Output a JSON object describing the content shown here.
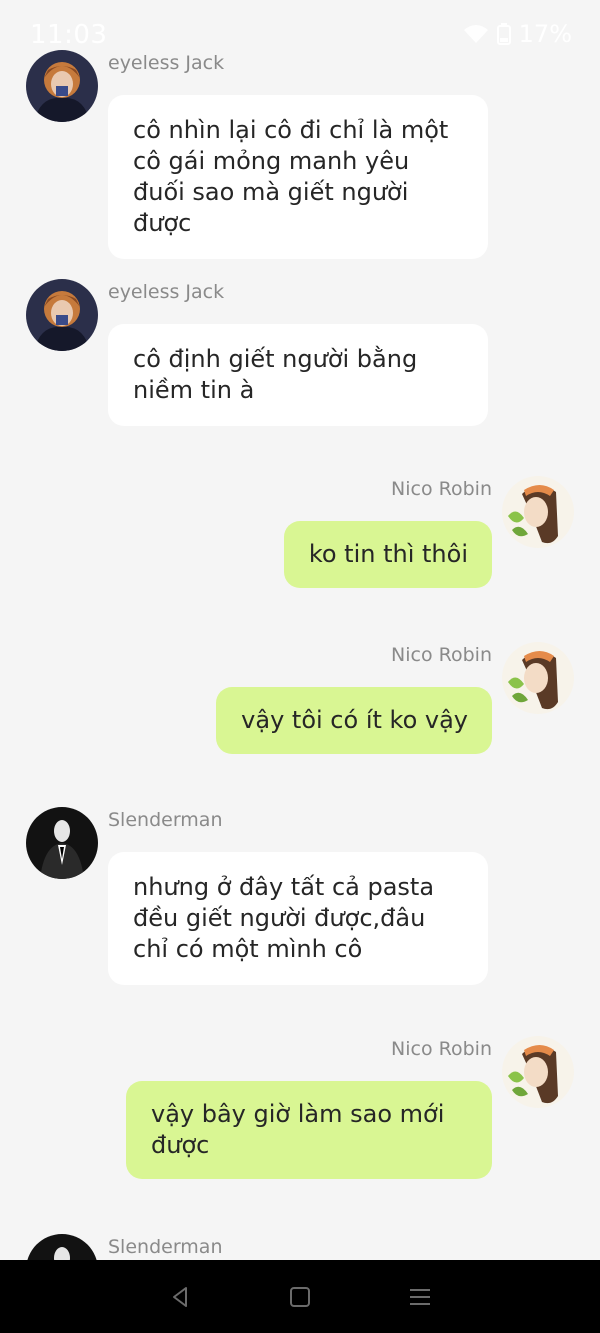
{
  "status_bar": {
    "time": "11:03",
    "battery": "17%",
    "icons": [
      "wifi-icon",
      "battery-icon"
    ]
  },
  "messages": [
    {
      "side": "left",
      "sender": "eyeless Jack",
      "avatar": "eyeless-jack-avatar",
      "text": "cô nhìn lại cô đi chỉ là một cô gái mỏng manh yêu đuối sao mà giết người được"
    },
    {
      "side": "left",
      "sender": "eyeless Jack",
      "avatar": "eyeless-jack-avatar",
      "text": "cô định giết người bằng niềm tin à"
    },
    {
      "side": "right",
      "sender": "Nico Robin",
      "avatar": "nico-robin-avatar",
      "text": "ko tin thì thôi"
    },
    {
      "side": "right",
      "sender": "Nico Robin",
      "avatar": "nico-robin-avatar",
      "text": "vậy tôi có ít ko vậy"
    },
    {
      "side": "left",
      "sender": "Slenderman",
      "avatar": "slenderman-avatar",
      "text": "nhưng ở đây tất cả pasta đều giết người được,đâu chỉ có một mình cô"
    },
    {
      "side": "right",
      "sender": "Nico Robin",
      "avatar": "nico-robin-avatar",
      "text": "vậy bây giờ làm sao mới được"
    },
    {
      "side": "left",
      "sender": "Slenderman",
      "avatar": "slenderman-avatar",
      "text": ""
    }
  ],
  "nav_bar": {
    "buttons": [
      "back-icon",
      "home-icon",
      "recents-icon"
    ]
  },
  "colors": {
    "background": "#f5f5f5",
    "incoming_bubble": "#ffffff",
    "outgoing_bubble": "#d9f693",
    "sender_name": "#8a8a8a",
    "nav_bar": "#000000"
  }
}
